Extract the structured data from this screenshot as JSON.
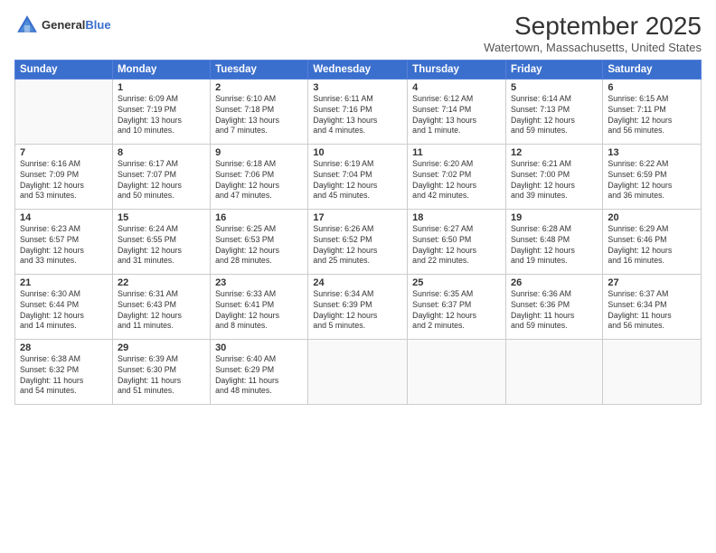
{
  "header": {
    "logo_general": "General",
    "logo_blue": "Blue",
    "title": "September 2025",
    "location": "Watertown, Massachusetts, United States"
  },
  "columns": [
    "Sunday",
    "Monday",
    "Tuesday",
    "Wednesday",
    "Thursday",
    "Friday",
    "Saturday"
  ],
  "weeks": [
    [
      {
        "day": "",
        "info": ""
      },
      {
        "day": "1",
        "info": "Sunrise: 6:09 AM\nSunset: 7:19 PM\nDaylight: 13 hours\nand 10 minutes."
      },
      {
        "day": "2",
        "info": "Sunrise: 6:10 AM\nSunset: 7:18 PM\nDaylight: 13 hours\nand 7 minutes."
      },
      {
        "day": "3",
        "info": "Sunrise: 6:11 AM\nSunset: 7:16 PM\nDaylight: 13 hours\nand 4 minutes."
      },
      {
        "day": "4",
        "info": "Sunrise: 6:12 AM\nSunset: 7:14 PM\nDaylight: 13 hours\nand 1 minute."
      },
      {
        "day": "5",
        "info": "Sunrise: 6:14 AM\nSunset: 7:13 PM\nDaylight: 12 hours\nand 59 minutes."
      },
      {
        "day": "6",
        "info": "Sunrise: 6:15 AM\nSunset: 7:11 PM\nDaylight: 12 hours\nand 56 minutes."
      }
    ],
    [
      {
        "day": "7",
        "info": "Sunrise: 6:16 AM\nSunset: 7:09 PM\nDaylight: 12 hours\nand 53 minutes."
      },
      {
        "day": "8",
        "info": "Sunrise: 6:17 AM\nSunset: 7:07 PM\nDaylight: 12 hours\nand 50 minutes."
      },
      {
        "day": "9",
        "info": "Sunrise: 6:18 AM\nSunset: 7:06 PM\nDaylight: 12 hours\nand 47 minutes."
      },
      {
        "day": "10",
        "info": "Sunrise: 6:19 AM\nSunset: 7:04 PM\nDaylight: 12 hours\nand 45 minutes."
      },
      {
        "day": "11",
        "info": "Sunrise: 6:20 AM\nSunset: 7:02 PM\nDaylight: 12 hours\nand 42 minutes."
      },
      {
        "day": "12",
        "info": "Sunrise: 6:21 AM\nSunset: 7:00 PM\nDaylight: 12 hours\nand 39 minutes."
      },
      {
        "day": "13",
        "info": "Sunrise: 6:22 AM\nSunset: 6:59 PM\nDaylight: 12 hours\nand 36 minutes."
      }
    ],
    [
      {
        "day": "14",
        "info": "Sunrise: 6:23 AM\nSunset: 6:57 PM\nDaylight: 12 hours\nand 33 minutes."
      },
      {
        "day": "15",
        "info": "Sunrise: 6:24 AM\nSunset: 6:55 PM\nDaylight: 12 hours\nand 31 minutes."
      },
      {
        "day": "16",
        "info": "Sunrise: 6:25 AM\nSunset: 6:53 PM\nDaylight: 12 hours\nand 28 minutes."
      },
      {
        "day": "17",
        "info": "Sunrise: 6:26 AM\nSunset: 6:52 PM\nDaylight: 12 hours\nand 25 minutes."
      },
      {
        "day": "18",
        "info": "Sunrise: 6:27 AM\nSunset: 6:50 PM\nDaylight: 12 hours\nand 22 minutes."
      },
      {
        "day": "19",
        "info": "Sunrise: 6:28 AM\nSunset: 6:48 PM\nDaylight: 12 hours\nand 19 minutes."
      },
      {
        "day": "20",
        "info": "Sunrise: 6:29 AM\nSunset: 6:46 PM\nDaylight: 12 hours\nand 16 minutes."
      }
    ],
    [
      {
        "day": "21",
        "info": "Sunrise: 6:30 AM\nSunset: 6:44 PM\nDaylight: 12 hours\nand 14 minutes."
      },
      {
        "day": "22",
        "info": "Sunrise: 6:31 AM\nSunset: 6:43 PM\nDaylight: 12 hours\nand 11 minutes."
      },
      {
        "day": "23",
        "info": "Sunrise: 6:33 AM\nSunset: 6:41 PM\nDaylight: 12 hours\nand 8 minutes."
      },
      {
        "day": "24",
        "info": "Sunrise: 6:34 AM\nSunset: 6:39 PM\nDaylight: 12 hours\nand 5 minutes."
      },
      {
        "day": "25",
        "info": "Sunrise: 6:35 AM\nSunset: 6:37 PM\nDaylight: 12 hours\nand 2 minutes."
      },
      {
        "day": "26",
        "info": "Sunrise: 6:36 AM\nSunset: 6:36 PM\nDaylight: 11 hours\nand 59 minutes."
      },
      {
        "day": "27",
        "info": "Sunrise: 6:37 AM\nSunset: 6:34 PM\nDaylight: 11 hours\nand 56 minutes."
      }
    ],
    [
      {
        "day": "28",
        "info": "Sunrise: 6:38 AM\nSunset: 6:32 PM\nDaylight: 11 hours\nand 54 minutes."
      },
      {
        "day": "29",
        "info": "Sunrise: 6:39 AM\nSunset: 6:30 PM\nDaylight: 11 hours\nand 51 minutes."
      },
      {
        "day": "30",
        "info": "Sunrise: 6:40 AM\nSunset: 6:29 PM\nDaylight: 11 hours\nand 48 minutes."
      },
      {
        "day": "",
        "info": ""
      },
      {
        "day": "",
        "info": ""
      },
      {
        "day": "",
        "info": ""
      },
      {
        "day": "",
        "info": ""
      }
    ]
  ]
}
